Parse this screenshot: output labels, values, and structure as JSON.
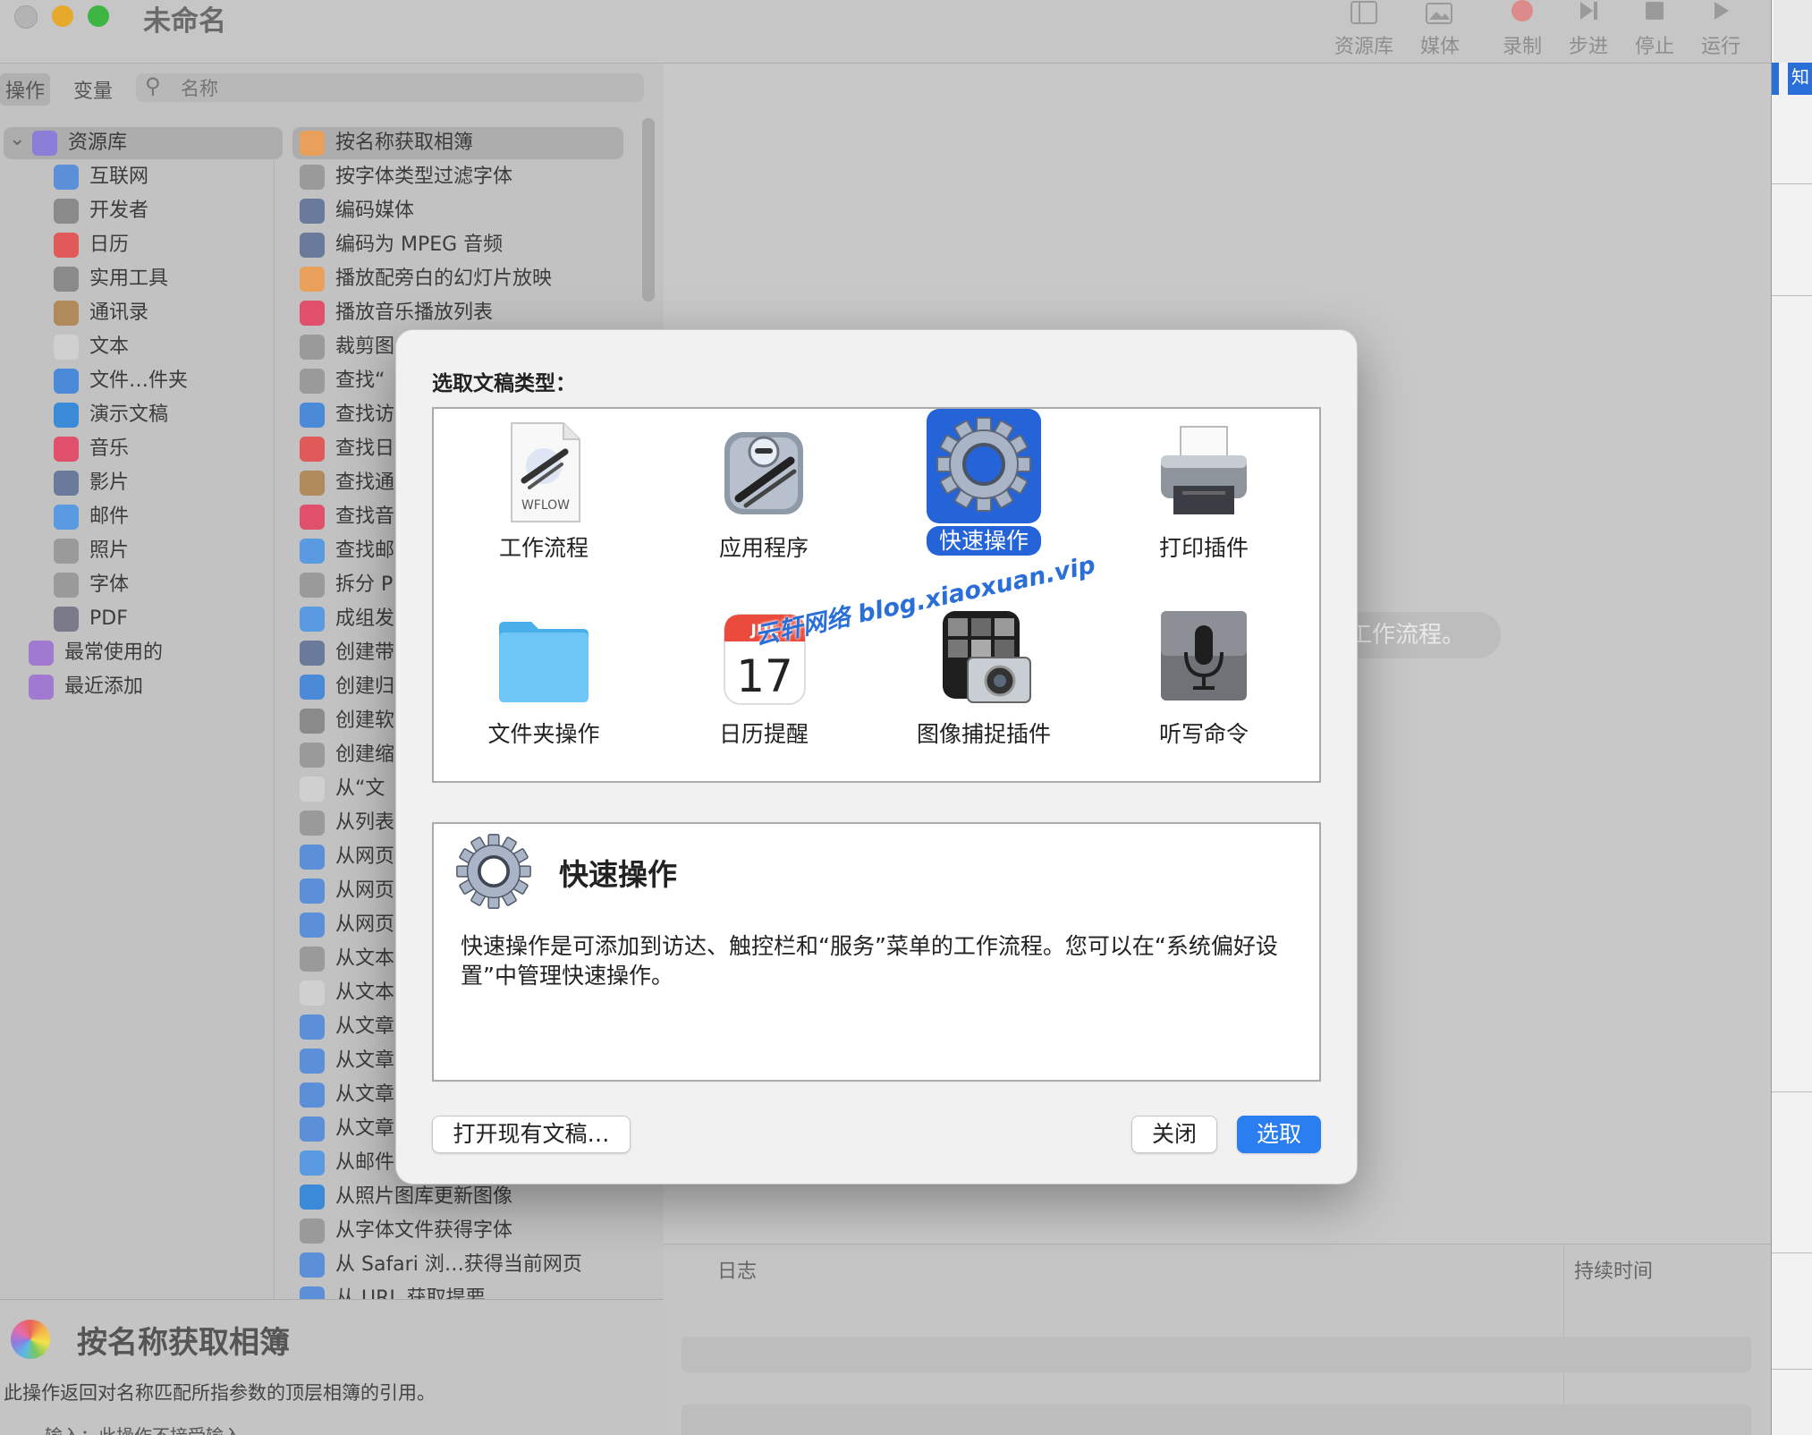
{
  "window": {
    "title": "未命名"
  },
  "toolbar": {
    "items": [
      {
        "label": "资源库",
        "icon": "library-icon"
      },
      {
        "label": "媒体",
        "icon": "media-icon"
      },
      {
        "label": "录制",
        "icon": "record-icon"
      },
      {
        "label": "步进",
        "icon": "step-icon"
      },
      {
        "label": "停止",
        "icon": "stop-icon"
      },
      {
        "label": "运行",
        "icon": "run-icon"
      }
    ]
  },
  "leftpane": {
    "tabs": [
      "操作",
      "变量"
    ],
    "search_placeholder": "名称",
    "library": [
      {
        "label": "资源库",
        "color": "#8a7ed8"
      },
      {
        "label": "互联网",
        "color": "#5b8fd8"
      },
      {
        "label": "开发者",
        "color": "#8a8a8a"
      },
      {
        "label": "日历",
        "color": "#e05a5a"
      },
      {
        "label": "实用工具",
        "color": "#8a8a8a"
      },
      {
        "label": "通讯录",
        "color": "#b08a5a"
      },
      {
        "label": "文本",
        "color": "#d0d0d0"
      },
      {
        "label": "文件…件夹",
        "color": "#4a8ad8"
      },
      {
        "label": "演示文稿",
        "color": "#3a8ad8"
      },
      {
        "label": "音乐",
        "color": "#e0506a"
      },
      {
        "label": "影片",
        "color": "#6a7a9a"
      },
      {
        "label": "邮件",
        "color": "#5a9ae0"
      },
      {
        "label": "照片",
        "color": "#9a9a9a"
      },
      {
        "label": "字体",
        "color": "#9a9a9a"
      },
      {
        "label": "PDF",
        "color": "#7a7a8a"
      },
      {
        "label": "最常使用的",
        "color": "#a07ad0"
      },
      {
        "label": "最近添加",
        "color": "#a07ad0"
      }
    ],
    "actions": [
      {
        "label": "按名称获取相簿",
        "color": "#e8a05a"
      },
      {
        "label": "按字体类型过滤字体",
        "color": "#9a9a9a"
      },
      {
        "label": "编码媒体",
        "color": "#6a7a9a"
      },
      {
        "label": "编码为 MPEG 音频",
        "color": "#6a7a9a"
      },
      {
        "label": "播放配旁白的幻灯片放映",
        "color": "#e8a05a"
      },
      {
        "label": "播放音乐播放列表",
        "color": "#e0506a"
      },
      {
        "label": "裁剪图",
        "color": "#9a9a9a"
      },
      {
        "label": "查找“",
        "color": "#9a9a9a"
      },
      {
        "label": "查找访",
        "color": "#4a8ad8"
      },
      {
        "label": "查找日",
        "color": "#e05a5a"
      },
      {
        "label": "查找通",
        "color": "#b08a5a"
      },
      {
        "label": "查找音",
        "color": "#e0506a"
      },
      {
        "label": "查找邮",
        "color": "#5a9ae0"
      },
      {
        "label": "拆分 P",
        "color": "#9a9a9a"
      },
      {
        "label": "成组发",
        "color": "#5a9ae0"
      },
      {
        "label": "创建带",
        "color": "#6a7a9a"
      },
      {
        "label": "创建归",
        "color": "#4a8ad8"
      },
      {
        "label": "创建软",
        "color": "#8a8a8a"
      },
      {
        "label": "创建缩",
        "color": "#9a9a9a"
      },
      {
        "label": "从“文",
        "color": "#d0d0d0"
      },
      {
        "label": "从列表",
        "color": "#9a9a9a"
      },
      {
        "label": "从网页",
        "color": "#5b8fd8"
      },
      {
        "label": "从网页",
        "color": "#5b8fd8"
      },
      {
        "label": "从网页",
        "color": "#5b8fd8"
      },
      {
        "label": "从文本",
        "color": "#9a9a9a"
      },
      {
        "label": "从文本",
        "color": "#d0d0d0"
      },
      {
        "label": "从文章",
        "color": "#5b8fd8"
      },
      {
        "label": "从文章",
        "color": "#5b8fd8"
      },
      {
        "label": "从文章",
        "color": "#5b8fd8"
      },
      {
        "label": "从文章",
        "color": "#5b8fd8"
      },
      {
        "label": "从邮件",
        "color": "#5a9ae0"
      },
      {
        "label": "从照片图库更新图像",
        "color": "#3a8ad8"
      },
      {
        "label": "从字体文件获得字体",
        "color": "#9a9a9a"
      },
      {
        "label": "从 Safari 浏…获得当前网页",
        "color": "#5b8fd8"
      },
      {
        "label": "从 URL 获取提要",
        "color": "#5b8fd8"
      }
    ],
    "info": {
      "title": "按名称获取相簿",
      "description": "此操作返回对名称匹配所指参数的顶层相簿的引用。",
      "input": "输入：此操作不接受输入"
    }
  },
  "main": {
    "hint": "工作流程。",
    "log": {
      "col_log": "日志",
      "col_duration": "持续时间"
    }
  },
  "dialog": {
    "title": "选取文稿类型：",
    "types": [
      {
        "label": "工作流程",
        "icon": "workflow-file-icon",
        "badge": "WFLOW"
      },
      {
        "label": "应用程序",
        "icon": "automator-robot-icon"
      },
      {
        "label": "快速操作",
        "icon": "gear-icon",
        "selected": true
      },
      {
        "label": "打印插件",
        "icon": "printer-icon"
      },
      {
        "label": "文件夹操作",
        "icon": "folder-icon"
      },
      {
        "label": "日历提醒",
        "icon": "calendar-icon",
        "month": "JUL",
        "day": "17"
      },
      {
        "label": "图像捕捉插件",
        "icon": "image-capture-icon"
      },
      {
        "label": "听写命令",
        "icon": "microphone-icon"
      }
    ],
    "description": {
      "title": "快速操作",
      "text": "快速操作是可添加到访达、触控栏和“服务”菜单的工作流程。您可以在“系统偏好设置”中管理快速操作。"
    },
    "buttons": {
      "open_existing": "打开现有文稿…",
      "close": "关闭",
      "choose": "选取"
    }
  },
  "watermark": "云轩网络 blog.xiaoxuan.vip"
}
